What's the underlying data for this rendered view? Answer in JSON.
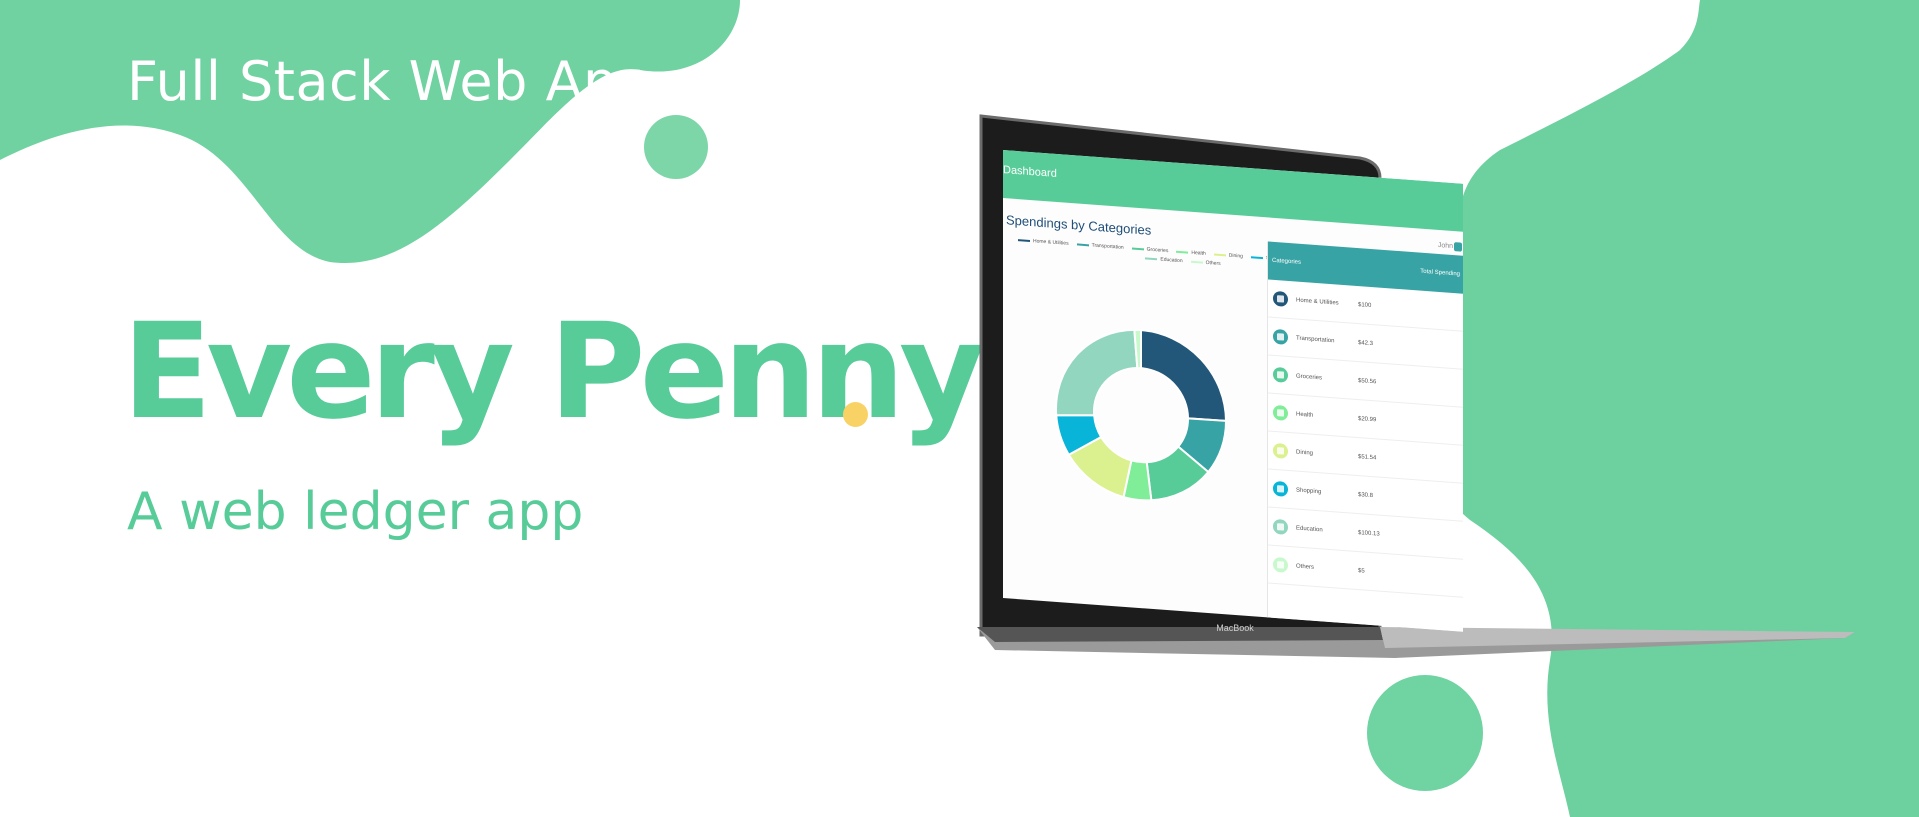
{
  "hero": {
    "tagline": "Full Stack Web App",
    "brand": "Every Penny",
    "subtitle": "A web ledger app"
  },
  "colors": {
    "accent": "#57cc99",
    "blob": "#6fd3a2",
    "dot": "#f8d265",
    "teal": "#38a3a5",
    "navy": "#22577a"
  },
  "laptop": {
    "label": "MacBook",
    "appbar_title": "Dashboard",
    "chart_title": "Spendings by Categories",
    "user": "John",
    "legend": [
      {
        "name": "Home & Utilities",
        "color": "#22577a"
      },
      {
        "name": "Transportation",
        "color": "#38a3a5"
      },
      {
        "name": "Groceries",
        "color": "#57cc99"
      },
      {
        "name": "Health",
        "color": "#80ed99"
      },
      {
        "name": "Dining",
        "color": "#dbf08e"
      },
      {
        "name": "Shopping",
        "color": "#08b4d8"
      },
      {
        "name": "Education",
        "color": "#92d6c0"
      },
      {
        "name": "Others",
        "color": "#c7f9cc"
      }
    ],
    "table": {
      "header_category": "Categories",
      "header_total": "Total Spending",
      "rows": [
        {
          "icon": "home-icon",
          "category": "Home & Utilities",
          "amount": "$100",
          "color": "#22577a"
        },
        {
          "icon": "bus-icon",
          "category": "Transportation",
          "amount": "$42.3",
          "color": "#38a3a5"
        },
        {
          "icon": "cart-icon",
          "category": "Groceries",
          "amount": "$50.56",
          "color": "#57cc99"
        },
        {
          "icon": "health-icon",
          "category": "Health",
          "amount": "$20.99",
          "color": "#80ed99"
        },
        {
          "icon": "dining-icon",
          "category": "Dining",
          "amount": "$51.54",
          "color": "#dbf08e"
        },
        {
          "icon": "bag-icon",
          "category": "Shopping",
          "amount": "$30.8",
          "color": "#08b4d8"
        },
        {
          "icon": "education-icon",
          "category": "Education",
          "amount": "$100.13",
          "color": "#92d6c0"
        },
        {
          "icon": "others-icon",
          "category": "Others",
          "amount": "$5",
          "color": "#c7f9cc"
        }
      ]
    }
  },
  "chart_data": {
    "type": "pie",
    "categories": [
      "Home & Utilities",
      "Transportation",
      "Groceries",
      "Health",
      "Dining",
      "Shopping",
      "Education",
      "Others"
    ],
    "values": [
      100,
      42.3,
      50.56,
      20.99,
      51.54,
      30.8,
      100.13,
      5
    ],
    "title": "Spendings by Categories"
  }
}
